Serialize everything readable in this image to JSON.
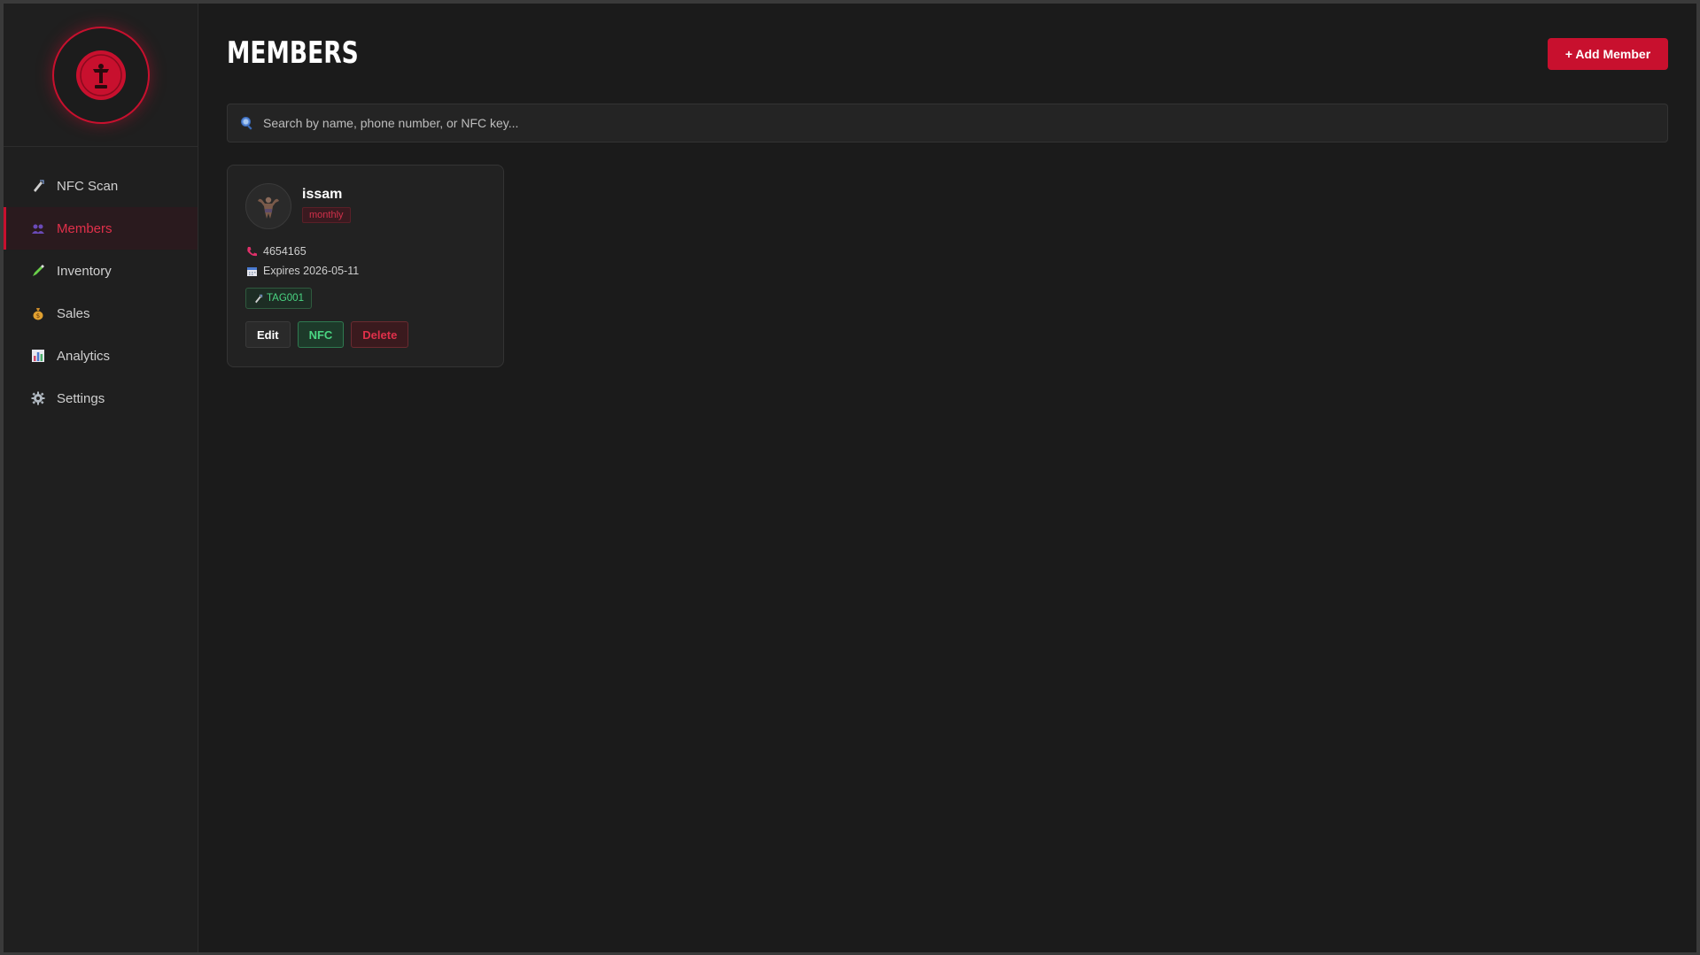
{
  "sidebar": {
    "items": [
      {
        "label": "NFC Scan",
        "icon": "nfc-icon"
      },
      {
        "label": "Members",
        "icon": "members-icon"
      },
      {
        "label": "Inventory",
        "icon": "inventory-icon"
      },
      {
        "label": "Sales",
        "icon": "money-bag-icon"
      },
      {
        "label": "Analytics",
        "icon": "chart-icon"
      },
      {
        "label": "Settings",
        "icon": "gear-icon"
      }
    ],
    "active_index": 1
  },
  "header": {
    "title": "MEMBERS",
    "add_button_label": "+ Add Member"
  },
  "search": {
    "placeholder": "Search by name, phone number, or NFC key...",
    "value": ""
  },
  "members": [
    {
      "name": "issam",
      "plan": "monthly",
      "phone": "4654165",
      "expires": "Expires 2026-05-11",
      "nfc_tag": "TAG001",
      "actions": {
        "edit": "Edit",
        "nfc": "NFC",
        "delete": "Delete"
      }
    }
  ],
  "colors": {
    "accent": "#c8102e",
    "background": "#1b1b1b",
    "sidebar": "#1f1f1f",
    "success": "#4ad582"
  }
}
